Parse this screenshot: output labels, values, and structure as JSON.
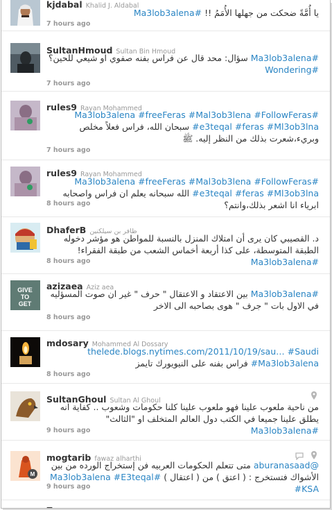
{
  "tweets": [
    {
      "username": "kjdabal",
      "fullname": "Khalid J. Aldabal",
      "body": [
        {
          "t": "يا أُمَّةً ضحكت من جهلها الأُمَمُ !! "
        },
        {
          "h": "#Ma3lob3alena"
        }
      ],
      "time": "7 hours ago"
    },
    {
      "username": "SultanHmoud",
      "fullname": "Sultan Bin Hmoud",
      "body": [
        {
          "h": "#Ma3lob3alena"
        },
        {
          "t": " سؤال: محد قال عن فراس بفنه صفوي او شيعي للحين؟ "
        },
        {
          "h": "#Wondering"
        }
      ],
      "time": "7 hours ago"
    },
    {
      "username": "rules9",
      "fullname": "Rayan Mohammed",
      "body": [
        {
          "h": "#Ma3lob3alena #freeFeras #Mal3ob3lena #FollowFeras #e3teqal #feras #Ml3ob3lna"
        },
        {
          "t": " سبحان الله، فراس فعلاً مخلص وبريء،شعرت بذلك من النظر إليه. ﷺ"
        }
      ],
      "time": "7 hours ago"
    },
    {
      "username": "rules9",
      "fullname": "Rayan Mohammed",
      "body": [
        {
          "h": "#Ma3lob3alena #freeFeras #Mal3ob3lena #FollowFeras #e3teqal #feras #Ml3ob3lna"
        },
        {
          "t": " الله سبحانه يعلم ان فراس واصحابه ابرياء انا اشعر بذلك،وانتم؟"
        }
      ],
      "time": "8 hours ago"
    },
    {
      "username": "DhaferB",
      "fullname": "ظافر بن سيلكنين",
      "body": [
        {
          "t": "د. القصيبي كان يرى أن امتلاك المنزل بالنسبة للمواطن هو مؤشر دخوله الطبقة المتوسطة، على كذا أربعة أخماس الشعب من طبقة الفقراء! "
        },
        {
          "h": "#Ma3lob3alena"
        }
      ],
      "time": "8 hours ago"
    },
    {
      "username": "azizaea",
      "fullname": "Aziz aea",
      "body": [
        {
          "h": "#Ma3lob3alena"
        },
        {
          "t": " بين الاعتقاد و الاعتقال \" حرف \" غير ان صوت المسؤليه في الاول بات \" جرف \" هوى بصاحبه الى الاخر"
        }
      ],
      "time": "8 hours ago"
    },
    {
      "username": "mdosary",
      "fullname": "Mohammed Al Dossary",
      "body": [
        {
          "h": "thelede.blogs.nytimes.com/2011/10/19/sau… #Saudi #Ma3lob3alena"
        },
        {
          "t": " فراس بفنه على النيويورك تايمز"
        }
      ],
      "time": "8 hours ago"
    },
    {
      "username": "SultanGhoul",
      "fullname": "Sultan Al Ghoul",
      "body": [
        {
          "t": "من ناحية ملعوب علينا فهو ملعوب علينا كلنا حكومات وشعوب .. كفاية انه يطلق علينا جميعا في الكتب دول العالم المتخلف او \"الثالث\" "
        },
        {
          "h": "#Ma3lob3alena"
        }
      ],
      "time": "9 hours ago"
    },
    {
      "username": "mogtarib",
      "fullname": "fawaz alharthi",
      "body": [
        {
          "h": "@aburanasaad"
        },
        {
          "t": " متى تتعلم الحكومات العربيه فن إستخراج الورده من بين الأشواك فتستخرج : ( اعتق ) من ( اعتقال ) "
        },
        {
          "h": "#Ma3lob3alena #E3teqal #KSA"
        }
      ],
      "time": "9 hours ago"
    },
    {
      "username": "Z",
      "fullname": "",
      "body": [],
      "time": ""
    }
  ],
  "colors": {
    "link": "#2a85c4",
    "username": "#333333",
    "meta": "#999999"
  },
  "icons": {
    "location": "map-pin-icon",
    "reply": "reply-icon"
  }
}
